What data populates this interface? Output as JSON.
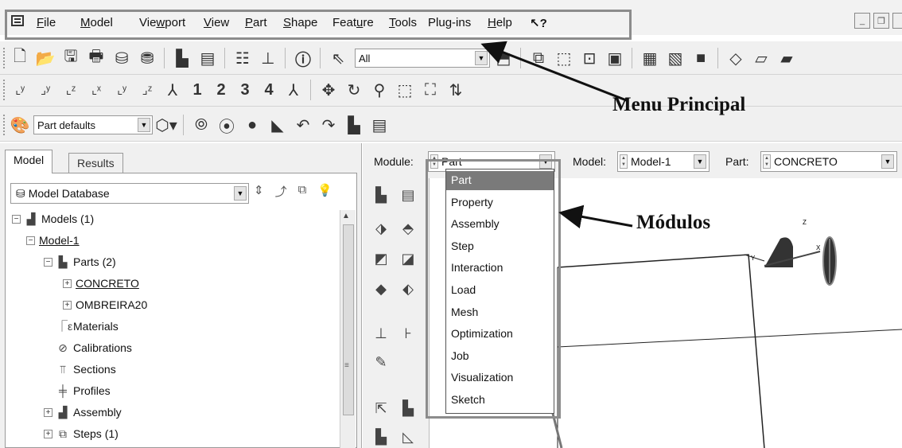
{
  "menubar": {
    "items": [
      {
        "label": "File",
        "u": "F",
        "rest": "ile"
      },
      {
        "label": "Model",
        "u": "M",
        "rest": "odel"
      },
      {
        "label": "Viewport",
        "pre": "Vie",
        "u": "w",
        "rest": "port"
      },
      {
        "label": "View",
        "u": "V",
        "rest": "iew"
      },
      {
        "label": "Part",
        "u": "P",
        "rest": "art"
      },
      {
        "label": "Shape",
        "u": "S",
        "rest": "hape"
      },
      {
        "label": "Feature",
        "pre": "Feat",
        "u": "u",
        "rest": "re"
      },
      {
        "label": "Tools",
        "u": "T",
        "rest": "ools"
      },
      {
        "label": "Plug-ins",
        "pre": "Plu",
        "u": "g",
        "rest": "-ins"
      },
      {
        "label": "Help",
        "u": "H",
        "rest": "elp"
      }
    ],
    "whats_this": "↖?"
  },
  "toolbar": {
    "selection_filter": "All",
    "view_numbers": [
      "1",
      "2",
      "3",
      "4"
    ],
    "part_defaults": "Part defaults"
  },
  "annotations": {
    "menu_principal": "Menu Principal",
    "modulos": "Módulos"
  },
  "left_panel": {
    "tabs": {
      "model": "Model",
      "results": "Results"
    },
    "database_combo": "Model Database",
    "tree": [
      {
        "label": "Models (1)"
      },
      {
        "label": "Model-1"
      },
      {
        "label": "Parts (2)"
      },
      {
        "label": "CONCRETO"
      },
      {
        "label": "OMBREIRA20"
      },
      {
        "label": "Materials"
      },
      {
        "label": "Calibrations"
      },
      {
        "label": "Sections"
      },
      {
        "label": "Profiles"
      },
      {
        "label": "Assembly"
      },
      {
        "label": "Steps (1)"
      }
    ]
  },
  "context": {
    "module_label": "Module:",
    "module_value": "Part",
    "model_label": "Model:",
    "model_value": "Model-1",
    "part_label": "Part:",
    "part_value": "CONCRETO"
  },
  "module_dropdown": {
    "options": [
      "Part",
      "Property",
      "Assembly",
      "Step",
      "Interaction",
      "Load",
      "Mesh",
      "Optimization",
      "Job",
      "Visualization",
      "Sketch"
    ],
    "selected": "Part"
  },
  "triad": {
    "z": "Z",
    "y": "Y",
    "x": "X"
  }
}
